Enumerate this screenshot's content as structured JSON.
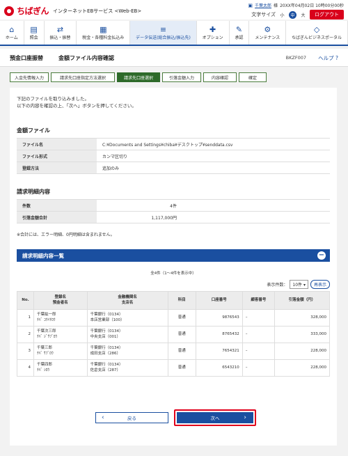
{
  "header": {
    "brand": "ちばぎん",
    "service": "インターネットEBサービス <Web-EB>",
    "user_link": "千葉太郎",
    "user_suffix": "様",
    "datetime": "20XX年04月02日 10時00分00秒",
    "font_size_label": "文字サイズ",
    "font_small": "小",
    "font_medium": "中",
    "font_large": "大",
    "logout": "ログアウト"
  },
  "nav": [
    {
      "label": "ホーム",
      "icon": "home-icon",
      "glyph": "⌂"
    },
    {
      "label": "照会",
      "icon": "doc-icon",
      "glyph": "▤"
    },
    {
      "label": "振込・振替",
      "icon": "transfer-icon",
      "glyph": "⇄"
    },
    {
      "label": "税金・各種料金払込み",
      "icon": "tax-icon",
      "glyph": "▦"
    },
    {
      "label": "データ伝送(総合振込/振込先)",
      "icon": "database-icon",
      "glyph": "≡"
    },
    {
      "label": "オプション",
      "icon": "option-icon",
      "glyph": "✚"
    },
    {
      "label": "承認",
      "icon": "approve-icon",
      "glyph": "✎"
    },
    {
      "label": "メンテナンス",
      "icon": "maintenance-icon",
      "glyph": "⚙"
    },
    {
      "label": "ちばぎんビジネスポータル",
      "icon": "portal-icon",
      "glyph": "◇"
    }
  ],
  "page": {
    "category": "預金口座振替",
    "title": "金額ファイル内容確認",
    "screen_id": "BKZF007",
    "help": "ヘルプ ?"
  },
  "steps": [
    "入金先情報入力",
    "請求先口座指定方法選択",
    "請求先口座選択",
    "引落金額入力",
    "内容確認",
    "確定"
  ],
  "message": [
    "下記のファイルを取り込みました。",
    "以下の内容を確認の上、「次へ」ボタンを押してください。"
  ],
  "file_section": {
    "title": "金額ファイル",
    "rows": [
      {
        "k": "ファイル名",
        "v": "C:¥Documents and Settings¥chiba¥デスクトップ¥senddata.csv"
      },
      {
        "k": "ファイル形式",
        "v": "カンマ区切り"
      },
      {
        "k": "登録方法",
        "v": "追加のみ"
      }
    ]
  },
  "billing_section": {
    "title": "請求明細内容",
    "rows": [
      {
        "k": "件数",
        "v": "4件"
      },
      {
        "k": "引落金額合計",
        "v": "1,117,000円"
      }
    ],
    "note": "※合計には、エラー明細、0円明細は含まれません。"
  },
  "list": {
    "title": "請求明細内容一覧",
    "count": "全4件（1～4件を表示中）",
    "display_label": "表示件数：",
    "display_value": "10件",
    "redisplay": "再表示",
    "headers": [
      "No.",
      "登録名\n預金者名",
      "金融機関名\n支店名",
      "科目",
      "口座番号",
      "顧客番号",
      "引落金額（円）"
    ],
    "rows": [
      {
        "no": "1",
        "name": "千葉紘一郎",
        "kana": "ﾁﾊﾞ ｺｳｲﾁﾛｳ",
        "bank": "千葉銀行（0134）",
        "branch": "本店営業部（100）",
        "type": "普通",
        "acct": "9876543",
        "cust": "–",
        "amount": "328,000"
      },
      {
        "no": "2",
        "name": "千葉次三郎",
        "kana": "ﾁﾊﾞ ｼﾞｻﾌﾞﾛｳ",
        "bank": "千葉銀行（0134）",
        "branch": "中央支店（001）",
        "type": "普通",
        "acct": "8765432",
        "cust": "–",
        "amount": "333,000"
      },
      {
        "no": "3",
        "name": "千葉三郎",
        "kana": "ﾁﾊﾞ ｻﾌﾞﾛｳ",
        "bank": "千葉銀行（0134）",
        "branch": "成田支店（286）",
        "type": "普通",
        "acct": "7654321",
        "cust": "–",
        "amount": "228,000"
      },
      {
        "no": "4",
        "name": "千葉四郎",
        "kana": "ﾁﾊﾞ ｼﾛｳ",
        "bank": "千葉銀行（0134）",
        "branch": "佐倉支店（287）",
        "type": "普通",
        "acct": "6543210",
        "cust": "–",
        "amount": "228,000"
      }
    ]
  },
  "buttons": {
    "back": "戻る",
    "next": "次へ"
  }
}
